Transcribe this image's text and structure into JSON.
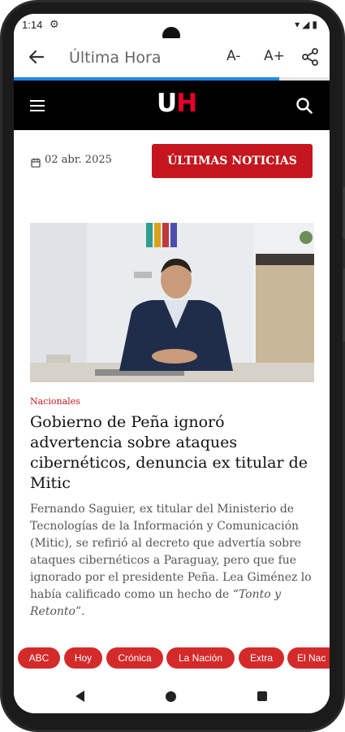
{
  "status_bar": {
    "time": "1:14",
    "settings_icon": "gear-icon",
    "indicators": "wifi-icon signal-icon battery-icon"
  },
  "app_bar": {
    "back_icon": "arrow-back-icon",
    "title": "Última Hora",
    "font_decrease_label": "A-",
    "font_increase_label": "A+",
    "share_icon": "share-icon"
  },
  "reading_progress": 0.84,
  "site_header": {
    "logo_u": "U",
    "logo_h": "H",
    "menu_icon": "hamburger-menu-icon",
    "search_icon": "search-icon"
  },
  "date_bar": {
    "calendar_icon": "calendar-icon",
    "date": "02 abr. 2025",
    "latest_news_label": "ÚLTIMAS NOTICIAS"
  },
  "article": {
    "image_icon": "photo-man-at-desk",
    "category": "Nacionales",
    "headline": "Gobierno de Peña ignoró advertencia sobre ataques cibernéticos, denuncia ex titular de Mitic",
    "lead_text": "Fernando Saguier, ex titular del Ministerio de Tecnologías de la Información y Comunicación (Mitic), se refirió al decreto que advertía sobre ataques cibernéticos a Paraguay, pero que fue ignorado por el presidente Peña. Lea Giménez lo había calificado como un hecho de “",
    "lead_quote": "Tonto y Retonto",
    "lead_end": "”."
  },
  "sources": [
    "ABC",
    "Hoy",
    "Crónica",
    "La Nación",
    "Extra",
    "El Nac"
  ],
  "colors": {
    "accent_red": "#c4161c",
    "chip_red": "#d42a2a",
    "progress_blue": "#1e88e5",
    "header_black": "#000000"
  }
}
